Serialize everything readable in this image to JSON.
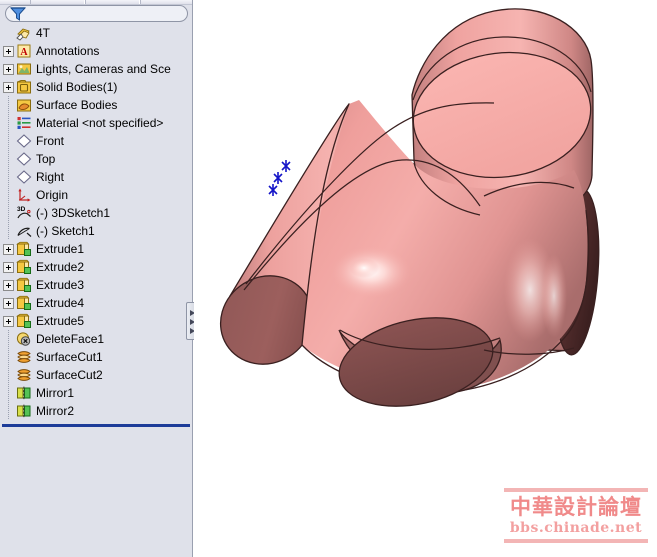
{
  "panel": {
    "filter": {
      "placeholder": "",
      "value": "",
      "icon": "filter-funnel-icon"
    },
    "root": {
      "label": "4T",
      "icon": "part-document-icon"
    },
    "items": [
      {
        "label": "Annotations",
        "icon": "annotations-icon",
        "expander": "plus",
        "indent": 1
      },
      {
        "label": "Lights, Cameras and Sce",
        "icon": "lights-cameras-icon",
        "expander": "plus",
        "indent": 1
      },
      {
        "label": "Solid Bodies(1)",
        "icon": "solid-bodies-icon",
        "expander": "plus",
        "indent": 1
      },
      {
        "label": "Surface Bodies",
        "icon": "surface-bodies-icon",
        "expander": "none",
        "indent": 1
      },
      {
        "label": "Material <not specified>",
        "icon": "material-icon",
        "expander": "none",
        "indent": 1
      },
      {
        "label": "Front",
        "icon": "plane-icon",
        "expander": "none",
        "indent": 1
      },
      {
        "label": "Top",
        "icon": "plane-icon",
        "expander": "none",
        "indent": 1
      },
      {
        "label": "Right",
        "icon": "plane-icon",
        "expander": "none",
        "indent": 1
      },
      {
        "label": "Origin",
        "icon": "origin-icon",
        "expander": "none",
        "indent": 1
      },
      {
        "label": "(-) 3DSketch1",
        "icon": "3d-sketch-icon",
        "expander": "none",
        "indent": 1
      },
      {
        "label": "(-) Sketch1",
        "icon": "sketch-icon",
        "expander": "none",
        "indent": 1
      },
      {
        "label": "Extrude1",
        "icon": "extrude-icon",
        "expander": "plus",
        "indent": 1
      },
      {
        "label": "Extrude2",
        "icon": "extrude-icon",
        "expander": "plus",
        "indent": 1
      },
      {
        "label": "Extrude3",
        "icon": "extrude-icon",
        "expander": "plus",
        "indent": 1
      },
      {
        "label": "Extrude4",
        "icon": "extrude-icon",
        "expander": "plus",
        "indent": 1
      },
      {
        "label": "Extrude5",
        "icon": "extrude-icon",
        "expander": "plus",
        "indent": 1
      },
      {
        "label": "DeleteFace1",
        "icon": "delete-face-icon",
        "expander": "none",
        "indent": 1
      },
      {
        "label": "SurfaceCut1",
        "icon": "surface-cut-icon",
        "expander": "none",
        "indent": 1
      },
      {
        "label": "SurfaceCut2",
        "icon": "surface-cut-icon",
        "expander": "none",
        "indent": 1
      },
      {
        "label": "Mirror1",
        "icon": "mirror-icon",
        "expander": "none",
        "indent": 1
      },
      {
        "label": "Mirror2",
        "icon": "mirror-icon",
        "expander": "none",
        "indent": 1
      }
    ],
    "rollback_bar": "rollback-bar",
    "splitter": "panel-splitter-handle"
  },
  "viewport": {
    "model_name": "4T",
    "description": "four-way pipe tee fitting, shaded solid",
    "background": "#ffffff",
    "colors": {
      "body_light": "#f2a3a0",
      "body_mid": "#e08f8d",
      "body_dark": "#b07070",
      "cap_dark": "#8b5050",
      "cap_darker": "#5e3333",
      "edge": "#3a2020",
      "highlight": "#ffffff",
      "origin_marker": "#1414c8"
    },
    "origin_marker": "origin-triad-marker"
  },
  "watermark": {
    "title": "中華設計論壇",
    "url": "bbs.chinade.net",
    "color": "#f08a8a"
  }
}
